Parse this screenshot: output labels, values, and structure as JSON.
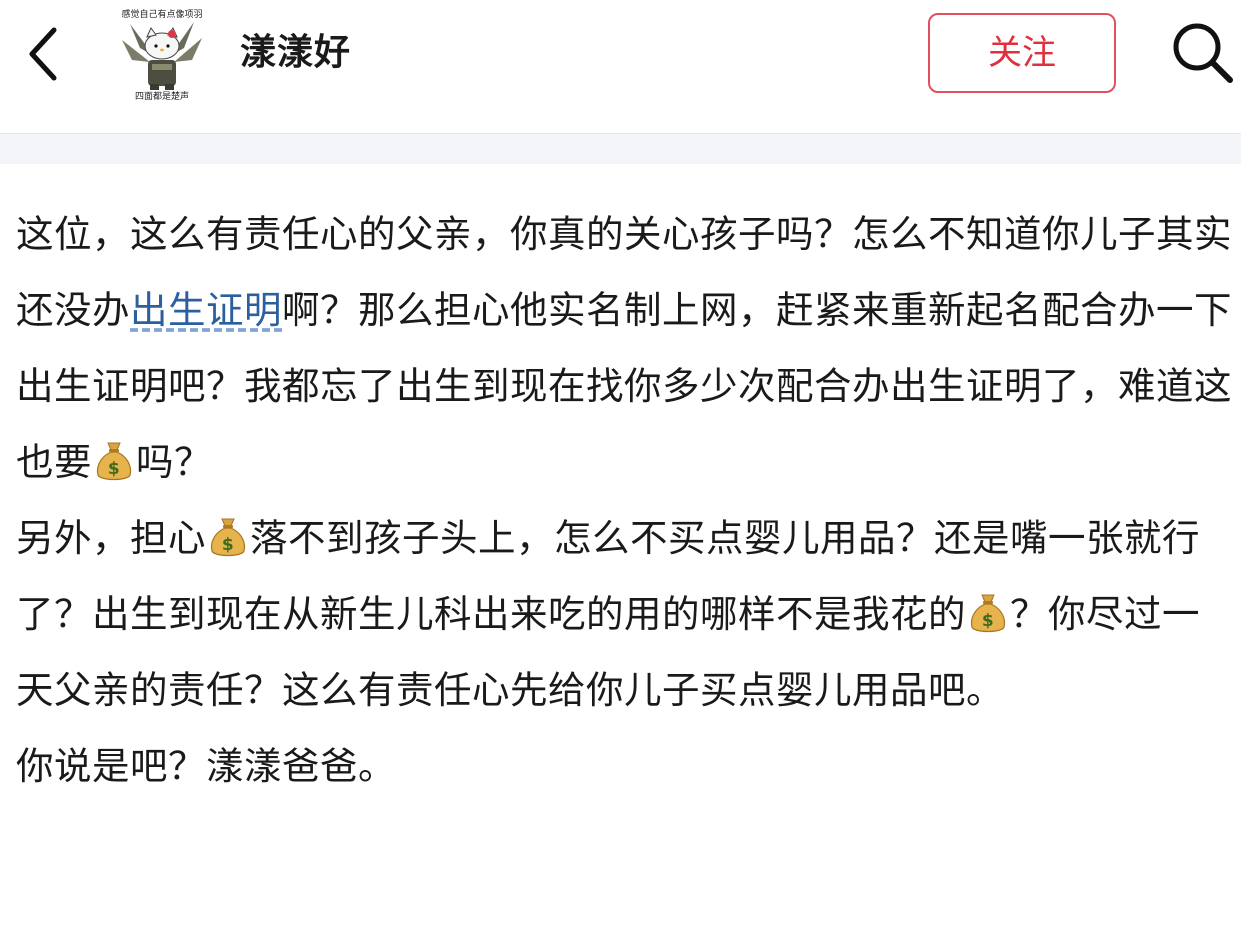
{
  "header": {
    "back_icon": "chevron-left-icon",
    "avatar": {
      "top_text": "感觉自己有点像项羽",
      "bottom_text": "四面都是楚声"
    },
    "username": "漾漾好",
    "follow_label": "关注",
    "search_icon": "search-icon"
  },
  "post": {
    "p1": {
      "t1": "这位，这么有责任心的父亲，你真的关心孩子吗？怎么不知道你儿子其实还没办",
      "link": "出生证明",
      "t2": "啊？那么担心他实名制上网，赶紧来重新起名配合办一下出生证明吧？我都忘了出生到现在找你多少次配合办出生证明了，难道这也要",
      "t3": "吗？"
    },
    "p2": {
      "t1": "另外，担心",
      "t2": "落不到孩子头上，怎么不买点婴儿用品？还是嘴一张就行了？出生到现在从新生儿科出来吃的用的哪样不是我花的",
      "t3": "？你尽过一天父亲的责任？这么有责任心先给你儿子买点婴儿用品吧。"
    },
    "p3": {
      "t1": "你说是吧？漾漾爸爸。"
    },
    "emoji_icon": "money-bag-icon"
  },
  "colors": {
    "follow_accent": "#e0303f",
    "link": "#2b5f9e",
    "divider_band": "#f3f5f8"
  }
}
